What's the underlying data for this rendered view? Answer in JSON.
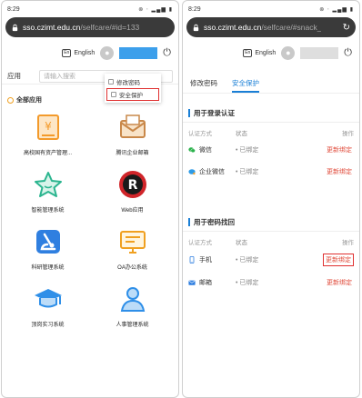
{
  "left": {
    "status": {
      "time": "8:29",
      "icons": "⊚ ⋅ ▂▄▆ ▮"
    },
    "url": {
      "domain": "sso.czimt.edu.cn",
      "path": "/selfcare/#id=133"
    },
    "lang_badge": "En",
    "lang": "English",
    "dropdown": [
      "修改密码",
      "安全保护"
    ],
    "app_label": "应用",
    "search_placeholder": "请输入搜索",
    "section_title": "全部应用",
    "apps": [
      {
        "name": "高校国有资产管理...",
        "icon": "finance-icon",
        "color": "#f39a2b"
      },
      {
        "name": "腾讯企业邮箱",
        "icon": "mail-icon",
        "color": "#e2a85f"
      },
      {
        "name": "智能管理系统",
        "icon": "star-icon",
        "color": "#2bb58f"
      },
      {
        "name": "Web应用",
        "icon": "web-app-icon",
        "color": "#d0252a"
      },
      {
        "name": "科研管理系统",
        "icon": "microscope-icon",
        "color": "#2f7fe0"
      },
      {
        "name": "OA办公系统",
        "icon": "monitor-icon",
        "color": "#f0a020"
      },
      {
        "name": "顶岗实习系统",
        "icon": "graduation-icon",
        "color": "#2f8fe8"
      },
      {
        "name": "人事管理系统",
        "icon": "person-icon",
        "color": "#2f8fe8"
      }
    ]
  },
  "right": {
    "status": {
      "time": "8:29",
      "icons": "⊚ ⋅ ▂▄▆ ▮"
    },
    "url": {
      "domain": "sso.czimt.edu.cn",
      "path": "/selfcare/#snack_"
    },
    "lang_badge": "En",
    "lang": "English",
    "tabs": [
      "修改密码",
      "安全保护"
    ],
    "login_section": {
      "title": "用于登录认证",
      "headers": [
        "认证方式",
        "状态",
        "操作"
      ],
      "rows": [
        {
          "method": "微信",
          "status": "• 已绑定",
          "action": "更新绑定"
        },
        {
          "method": "企业微信",
          "status": "• 已绑定",
          "action": "更新绑定"
        }
      ]
    },
    "recovery_section": {
      "title": "用于密码找回",
      "headers": [
        "认证方式",
        "状态",
        "操作"
      ],
      "rows": [
        {
          "method": "手机",
          "status": "• 已绑定",
          "action": "更新绑定"
        },
        {
          "method": "邮箱",
          "status": "• 已绑定",
          "action": "更新绑定"
        }
      ]
    }
  },
  "colors": {
    "accent": "#1a7fd6",
    "link": "#e04a3a",
    "highlight": "#e03030"
  }
}
